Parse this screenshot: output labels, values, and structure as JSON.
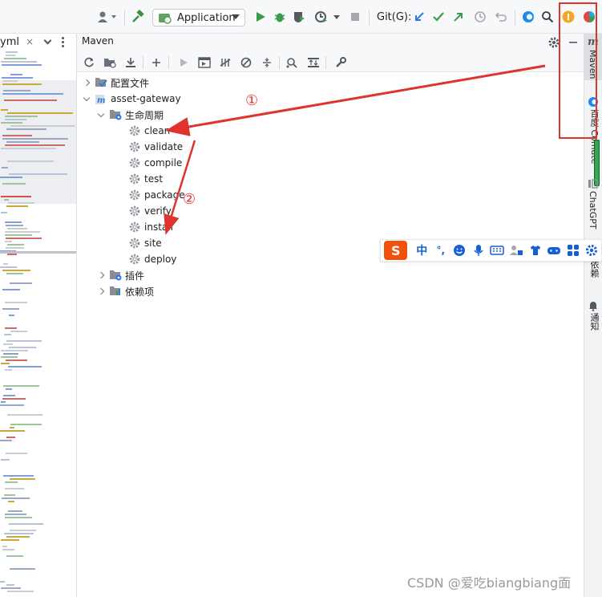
{
  "toolbar": {
    "run_config_label": "Application",
    "git_label": "Git(G):"
  },
  "editor": {
    "tab_label": "yml",
    "close_glyph": "×"
  },
  "maven": {
    "panel_title": "Maven",
    "tree": {
      "config_files": "配置文件",
      "project": "asset-gateway",
      "lifecycle": "生命周期",
      "goals": [
        "clean",
        "validate",
        "compile",
        "test",
        "package",
        "verify",
        "install",
        "site",
        "deploy"
      ],
      "plugins": "插件",
      "dependencies": "依赖项"
    }
  },
  "right_sidebar": {
    "maven": "Maven",
    "baidu_comate": "百度 Comate",
    "chatgpt": "ChatGPT",
    "dependency_analyzer": "依赖",
    "notifications": "通知"
  },
  "ime": {
    "logo": "S",
    "mode": "中",
    "punct": "°,"
  },
  "annotations": {
    "one": "①",
    "two": "②",
    "color": "#e0332e"
  },
  "watermark": "CSDN @爱吃biangbiang面"
}
